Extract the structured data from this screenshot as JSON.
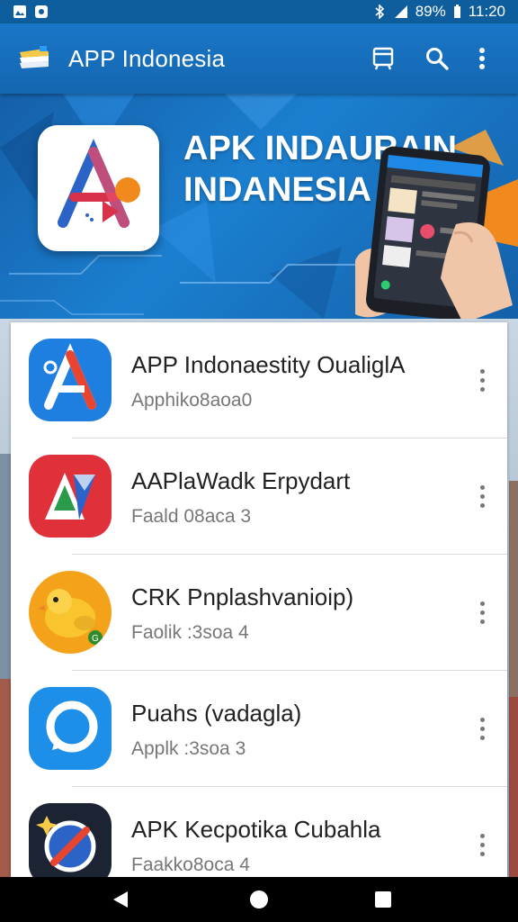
{
  "status_bar": {
    "battery": "89%",
    "time": "11:20",
    "icons": [
      "gallery-icon",
      "settings-icon",
      "bluetooth-icon",
      "signal-icon",
      "battery-icon"
    ]
  },
  "app_bar": {
    "title": "APP Indonesia",
    "icons": [
      "app-logo-icon",
      "store-icon",
      "search-icon",
      "more-vert-icon"
    ]
  },
  "banner": {
    "title_line1": "APK INDAURAIN",
    "title_line2": "INDANESIA"
  },
  "apps": [
    {
      "title": "APP Indonaestity OualiglA",
      "subtitle": "Apphiko8aoa0",
      "icon": "blue-a-logo-icon"
    },
    {
      "title": "AAPlaWadk Erpydart",
      "subtitle": "Faald 08aca 3",
      "icon": "red-a-logo-icon"
    },
    {
      "title": "CRK Pnplashvanioip)",
      "subtitle": "Faolik :3soa 4",
      "icon": "yellow-bird-icon"
    },
    {
      "title": "Puahs (vadagla)",
      "subtitle": "Applk :3soa 3",
      "icon": "blue-chat-icon"
    },
    {
      "title": "APK Kecpotika Cubahla",
      "subtitle": "Faakko8oca 4",
      "icon": "no-sign-icon"
    }
  ],
  "nav_bar": {
    "icons": [
      "back-icon",
      "home-icon",
      "recents-icon"
    ]
  },
  "colors": {
    "primary": "#1976c7",
    "status_bar": "#0e5d9c",
    "accent_orange": "#f08a1c"
  }
}
